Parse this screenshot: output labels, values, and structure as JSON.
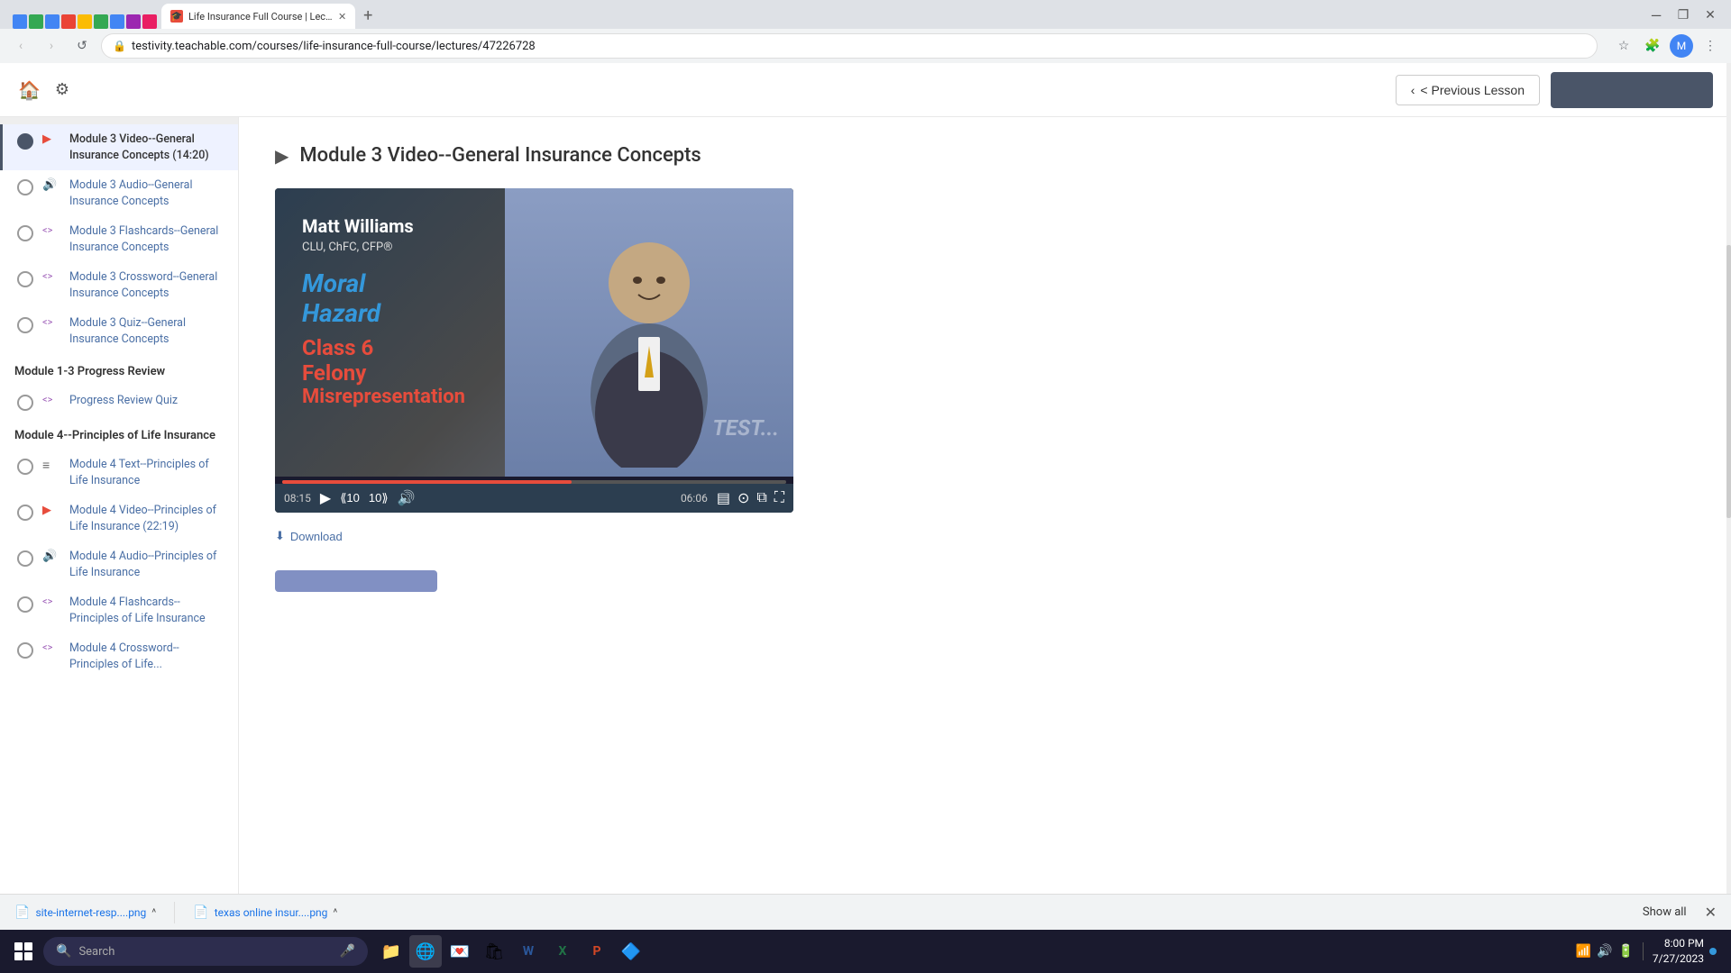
{
  "browser": {
    "tabs": [
      {
        "label": "Life Insurance Full Course | Lec...",
        "active": true,
        "favicon": "🎓"
      }
    ],
    "url": "testivity.teachable.com/courses/life-insurance-full-course/lectures/47226728",
    "nav": {
      "back_disabled": false,
      "forward_disabled": true
    }
  },
  "topbar": {
    "prev_lesson_label": "< Previous Lesson",
    "next_lesson_label": ""
  },
  "sidebar": {
    "sections": [
      {
        "id": "module3-content",
        "title": null,
        "items": [
          {
            "id": "m3-video",
            "type": "video",
            "type_icon": "▶",
            "label": "Module 3 Video--General Insurance Concepts (14:20)",
            "active": true
          },
          {
            "id": "m3-audio",
            "type": "audio",
            "type_icon": "🔊",
            "label": "Module 3 Audio--General Insurance Concepts",
            "active": false
          },
          {
            "id": "m3-flash",
            "type": "flashcards",
            "type_icon": "<>",
            "label": "Module 3 Flashcards--General Insurance Concepts",
            "active": false
          },
          {
            "id": "m3-cross",
            "type": "crossword",
            "type_icon": "<>",
            "label": "Module 3 Crossword--General Insurance Concepts",
            "active": false
          },
          {
            "id": "m3-quiz",
            "type": "quiz",
            "type_icon": "<>",
            "label": "Module 3 Quiz--General Insurance Concepts",
            "active": false
          }
        ]
      },
      {
        "id": "module-1-3-progress",
        "title": "Module 1-3 Progress Review",
        "items": [
          {
            "id": "progress-quiz",
            "type": "quiz",
            "type_icon": "<>",
            "label": "Progress Review Quiz",
            "active": false
          }
        ]
      },
      {
        "id": "module4",
        "title": "Module 4--Principles of Life Insurance",
        "items": [
          {
            "id": "m4-text",
            "type": "text",
            "type_icon": "≡",
            "label": "Module 4 Text--Principles of Life Insurance",
            "active": false
          },
          {
            "id": "m4-video",
            "type": "video",
            "type_icon": "▶",
            "label": "Module 4 Video--Principles of Life Insurance (22:19)",
            "active": false
          },
          {
            "id": "m4-audio",
            "type": "audio",
            "type_icon": "🔊",
            "label": "Module 4 Audio--Principles of Life Insurance",
            "active": false
          },
          {
            "id": "m4-flash",
            "type": "flashcards",
            "type_icon": "<>",
            "label": "Module 4 Flashcards--Principles of Life Insurance",
            "active": false
          },
          {
            "id": "m4-cross",
            "type": "crossword",
            "type_icon": "<>",
            "label": "Module 4 Crossword--Principles of Life...",
            "active": false
          }
        ]
      }
    ]
  },
  "content": {
    "lesson_title": "Module 3 Video--General Insurance Concepts",
    "video": {
      "presenter_name": "Matt Williams",
      "presenter_credentials": "CLU, ChFC, CFP®",
      "topics": [
        "Moral",
        "Hazard",
        "Class 6",
        "Felony",
        "Misrepresentation"
      ],
      "current_time": "08:15",
      "remaining_time": "06:06",
      "progress_percent": 57.5,
      "watermark": "TEST..."
    },
    "download_label": "Download",
    "complete_btn_label": ""
  },
  "download_bar": {
    "items": [
      {
        "name": "site-internet-resp....png",
        "icon": "📄"
      },
      {
        "name": "texas online insur....png",
        "icon": "📄"
      }
    ],
    "show_all": "Show all",
    "close_icon": "✕"
  },
  "taskbar": {
    "search_placeholder": "Search",
    "time": "8:00 PM",
    "date": "7/27/2023",
    "apps": [
      "📁",
      "🌐",
      "📧",
      "💻",
      "📝",
      "📊",
      "🎵",
      "🔒"
    ]
  }
}
